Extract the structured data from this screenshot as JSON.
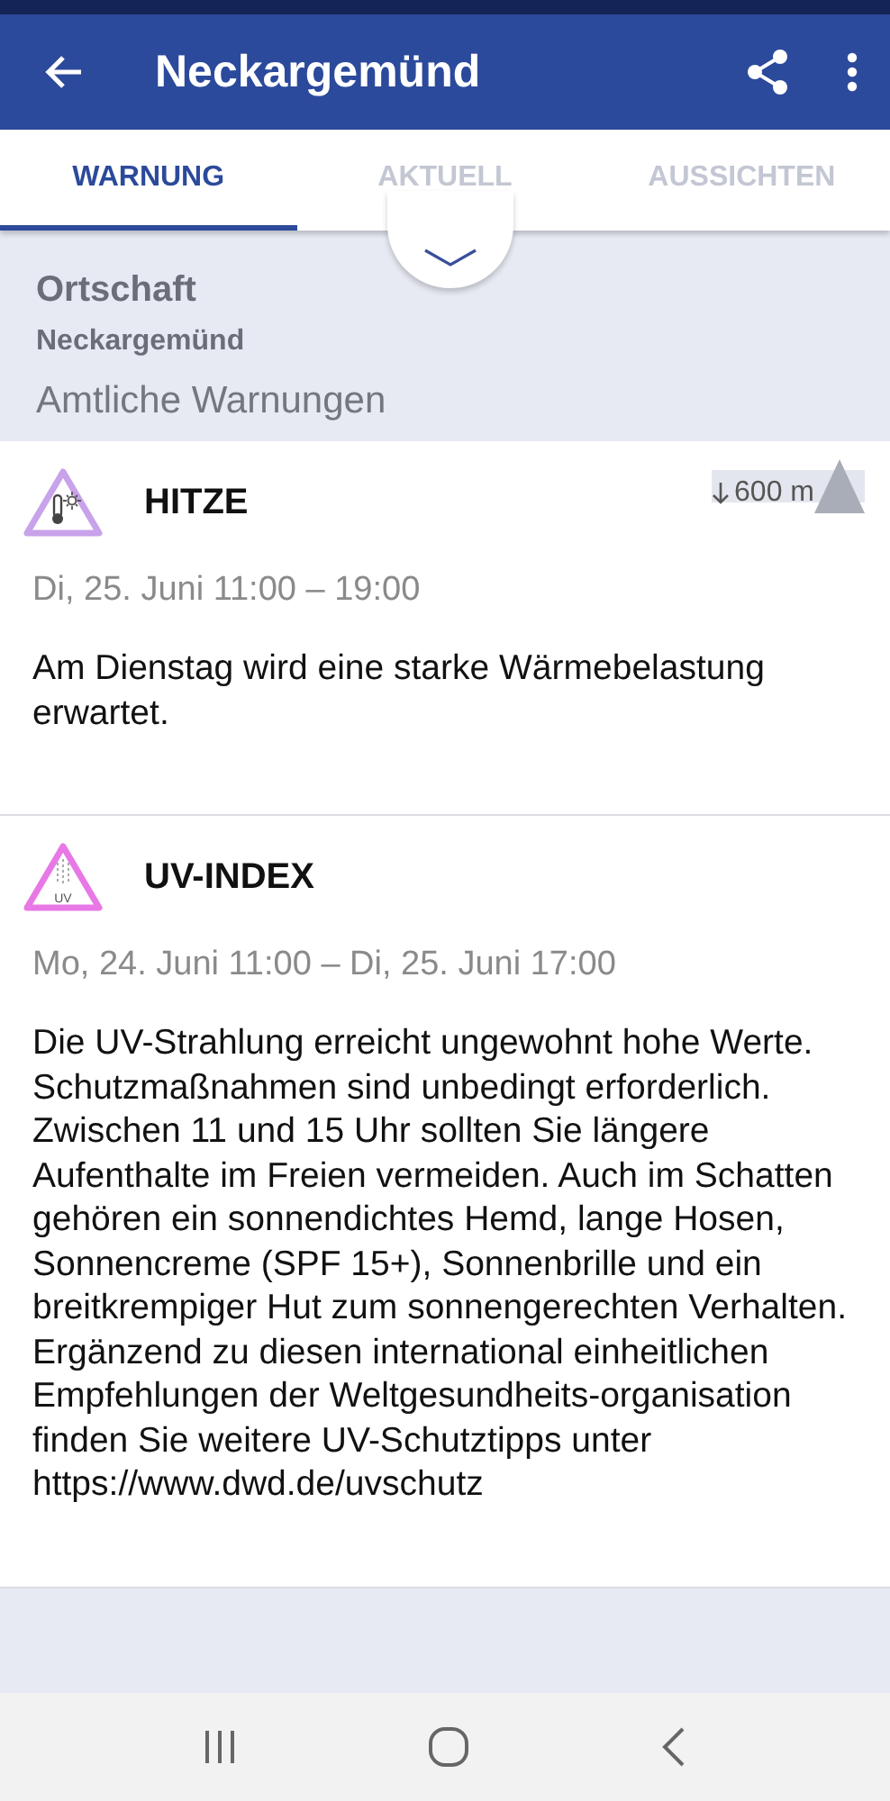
{
  "app_bar": {
    "title": "Neckargemünd"
  },
  "tabs": [
    {
      "label": "WARNUNG",
      "selected": true
    },
    {
      "label": "AKTUELL",
      "selected": false
    },
    {
      "label": "AUSSICHTEN",
      "selected": false
    }
  ],
  "location": {
    "heading": "Ortschaft",
    "name": "Neckargemünd",
    "section_title": "Amtliche Warnungen"
  },
  "warnings": [
    {
      "kind": "heat",
      "title": "HITZE",
      "color": "#c8a2ea",
      "altitude": "600 m",
      "period": "Di, 25. Juni 11:00 – 19:00",
      "text": "Am Dienstag wird eine starke Wärmebelastung erwartet."
    },
    {
      "kind": "uv",
      "title": "UV-INDEX",
      "color": "#e878e6",
      "icon_label": "UV",
      "period": "Mo, 24. Juni 11:00 – Di, 25. Juni 17:00",
      "text": "Die UV-Strahlung erreicht ungewohnt hohe Werte. Schutzmaßnahmen sind unbedingt erforderlich. Zwischen 11 und 15 Uhr sollten Sie längere Aufenthalte im Freien vermeiden. Auch im Schatten gehören ein sonnendichtes Hemd, lange Hosen, Sonnencreme (SPF 15+), Sonnenbrille und ein breitkrempiger Hut zum sonnengerechten Verhalten. Ergänzend zu diesen international einheitlichen Empfehlungen der Weltgesundheits-organisation finden Sie weitere UV-Schutztipps unter https://www.dwd.de/uvschutz"
    }
  ]
}
